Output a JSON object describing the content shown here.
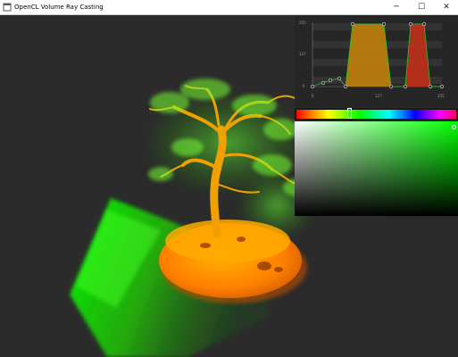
{
  "window": {
    "title": "OpenCL Volume Ray Casting",
    "minimize_glyph": "─",
    "maximize_glyph": "☐",
    "close_glyph": "✕"
  },
  "transfer_function": {
    "y_ticks": [
      "255",
      "127",
      "0"
    ],
    "x_ticks": [
      "0",
      "127",
      "255"
    ]
  },
  "colors": {
    "scene_background": "#2b2b2b",
    "panel_background": "#262626",
    "orange_band": "#c8860a",
    "red_band": "#c0301a",
    "green_curve": "#22cc22",
    "selected_color": "#00ff00"
  }
}
